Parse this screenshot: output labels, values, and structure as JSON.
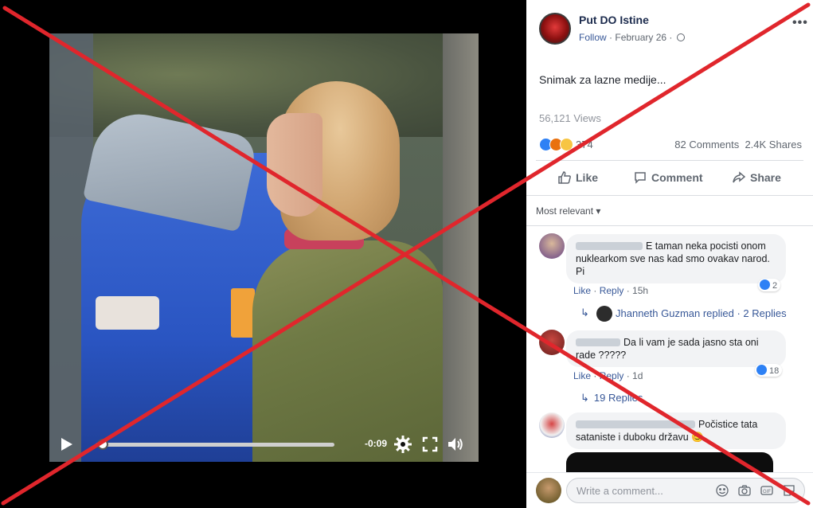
{
  "video": {
    "time_remaining": "-0:09",
    "progress_fraction": 0.03
  },
  "post": {
    "page_name": "Put DO Istine",
    "follow_label": "Follow",
    "date": "February 26",
    "text": "Snimak za lazne medije...",
    "views": "56,121 Views",
    "reaction_count": "374",
    "comments_count": "82 Comments",
    "shares_count": "2.4K Shares"
  },
  "actions": {
    "like": "Like",
    "comment": "Comment",
    "share": "Share"
  },
  "sort": {
    "label": "Most relevant"
  },
  "comments": [
    {
      "text": "E taman neka pocisti onom nuklearkom sve nas kad smo ovakav narod. Pi",
      "like_label": "Like",
      "reply_label": "Reply",
      "age": "15h",
      "reactions": "2",
      "replies_summary": "Jhanneth Guzman replied · 2 Replies"
    },
    {
      "text": "Da li vam je sada jasno sta oni rade ?????",
      "like_label": "Like",
      "reply_label": "Reply",
      "age": "1d",
      "reactions": "18",
      "replies_summary": "19 Replies"
    },
    {
      "text": "Počistice tata sataniste i duboku državu 😊"
    }
  ],
  "composer": {
    "placeholder": "Write a comment..."
  },
  "colors": {
    "overlay_x": "#e0262c",
    "link": "#385898",
    "like_blue": "#2e81f5"
  }
}
